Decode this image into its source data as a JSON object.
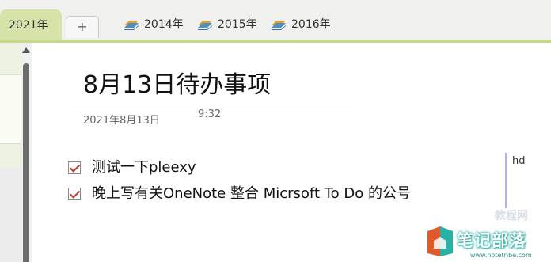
{
  "tabs": {
    "active_section": "2021年",
    "add_label": "+",
    "notebooks": [
      {
        "label": "2014年",
        "icon": "notebook-stack-icon"
      },
      {
        "label": "2015年",
        "icon": "notebook-stack-icon"
      },
      {
        "label": "2016年",
        "icon": "notebook-stack-icon"
      }
    ]
  },
  "page": {
    "title": "8月13日待办事项",
    "date": "2021年8月13日",
    "time": "9:32",
    "todos": [
      {
        "text": "测试一下pleexy",
        "checked": true
      },
      {
        "text": "晚上写有关OneNote 整合 Micrsoft To Do 的公号",
        "checked": true
      }
    ],
    "side_note": "hd"
  },
  "watermark": {
    "text": "笔记部落",
    "url": "www.notetribe.com",
    "ghost_text": "教程网"
  },
  "colors": {
    "active_tab": "#d5e3a9",
    "check_mark": "#c0392b",
    "watermark_teal": "#2bb0a6"
  }
}
